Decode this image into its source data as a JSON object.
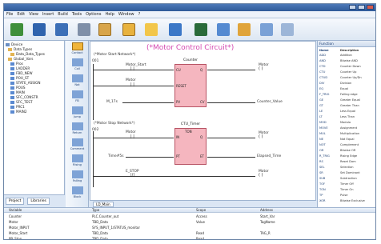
{
  "menu": [
    "File",
    "Edit",
    "View",
    "Insert",
    "Build",
    "Tools",
    "Options",
    "Help",
    "Window",
    "?"
  ],
  "toolbar_icons": [
    "new-project-icon",
    "open-icon",
    "save-icon",
    "cut-icon",
    "copy-icon",
    "paste-icon",
    "compile-icon",
    "download-icon",
    "monitor-icon",
    "debug-icon",
    "online-icon",
    "settings-icon"
  ],
  "tree": {
    "items": [
      "Device",
      "Data Types",
      "Data_Data_Types",
      "Global_Vars",
      "Pros",
      "LADDER",
      "FBD_NEW",
      "POU_ST",
      "STATE_ASSIGN",
      "POUS",
      "MAIN",
      "SFC_CONSTR",
      "SFC_TEST",
      "PRC1",
      "MAIN2"
    ]
  },
  "left_tabs": [
    "Project",
    "Libraries"
  ],
  "palette": [
    "Contact",
    "Coil",
    "Not",
    "FB",
    "Jump",
    "Return",
    "Comment",
    "Rising",
    "Falling",
    "Block"
  ],
  "ladder": {
    "title": "(*Motor Control Circuit*)",
    "net1_comment": "(*Motor Start Network*)",
    "net1_num": "001",
    "net2_comment": "(*Motor Stop Network*)",
    "net2_num": "002",
    "block1_name": "Counter",
    "block1_pins_l": [
      "CU",
      "RESET",
      "PV"
    ],
    "block1_pins_r": [
      "Q",
      "",
      "CV"
    ],
    "block2_name": "CTU_Timer",
    "block2_type": "TON",
    "block2_pins_l": [
      "IN",
      "PT"
    ],
    "block2_pins_r": [
      "Q",
      "ET"
    ],
    "contact1": "Motor_Start",
    "contact2": "Motor",
    "var_pv": "M_17s",
    "var_cv": "Counter_Value",
    "coil1": "Motor",
    "contact3": "Motor",
    "var_pt": "Time#5s",
    "var_et": "Elapsed_Time",
    "contact4": "E_STOP",
    "coil2": "Motor"
  },
  "editor_tabs": [
    "LD_Main"
  ],
  "library": {
    "header": "Function",
    "cols": [
      "Name",
      "Description"
    ],
    "rows": [
      [
        "ADD",
        "Addition"
      ],
      [
        "AND",
        "Bitwise AND"
      ],
      [
        "CTD",
        "Counter Down"
      ],
      [
        "CTU",
        "Counter Up"
      ],
      [
        "CTUD",
        "Counter Up/Dn"
      ],
      [
        "DIV",
        "Division"
      ],
      [
        "EQ",
        "Equal"
      ],
      [
        "F_TRIG",
        "Falling edge"
      ],
      [
        "GE",
        "Greater Equal"
      ],
      [
        "GT",
        "Greater Than"
      ],
      [
        "LE",
        "Less Equal"
      ],
      [
        "LT",
        "Less Than"
      ],
      [
        "MOD",
        "Modulo"
      ],
      [
        "MOVE",
        "Assignment"
      ],
      [
        "MUL",
        "Multiplication"
      ],
      [
        "NE",
        "Not Equal"
      ],
      [
        "NOT",
        "Complement"
      ],
      [
        "OR",
        "Bitwise OR"
      ],
      [
        "R_TRIG",
        "Rising Edge"
      ],
      [
        "RS",
        "Reset Dom"
      ],
      [
        "SEL",
        "Selection"
      ],
      [
        "SR",
        "Set Dominant"
      ],
      [
        "SUB",
        "Subtraction"
      ],
      [
        "TOF",
        "Timer Off"
      ],
      [
        "TON",
        "Timer On"
      ],
      [
        "TP",
        "Pulse"
      ],
      [
        "XOR",
        "Bitwise Exclusive"
      ]
    ]
  },
  "bottom": {
    "cols": [
      "Variable",
      "Type",
      "Scope",
      "Address"
    ],
    "rows": [
      [
        "Counter",
        "PLC.Counter_out",
        "Access",
        "Start_Var"
      ],
      [
        "Motor",
        "TBD_Data",
        "Value",
        "TagName"
      ],
      [
        "Motor_INPUT",
        "SYS_INPUT_1/STATUS_monitor",
        "",
        ""
      ],
      [
        "Motor_Start",
        "TBD_Data",
        "Read",
        "TAG_R"
      ],
      [
        "PB_Stop",
        "TBD_Data",
        "Read",
        ""
      ]
    ]
  }
}
